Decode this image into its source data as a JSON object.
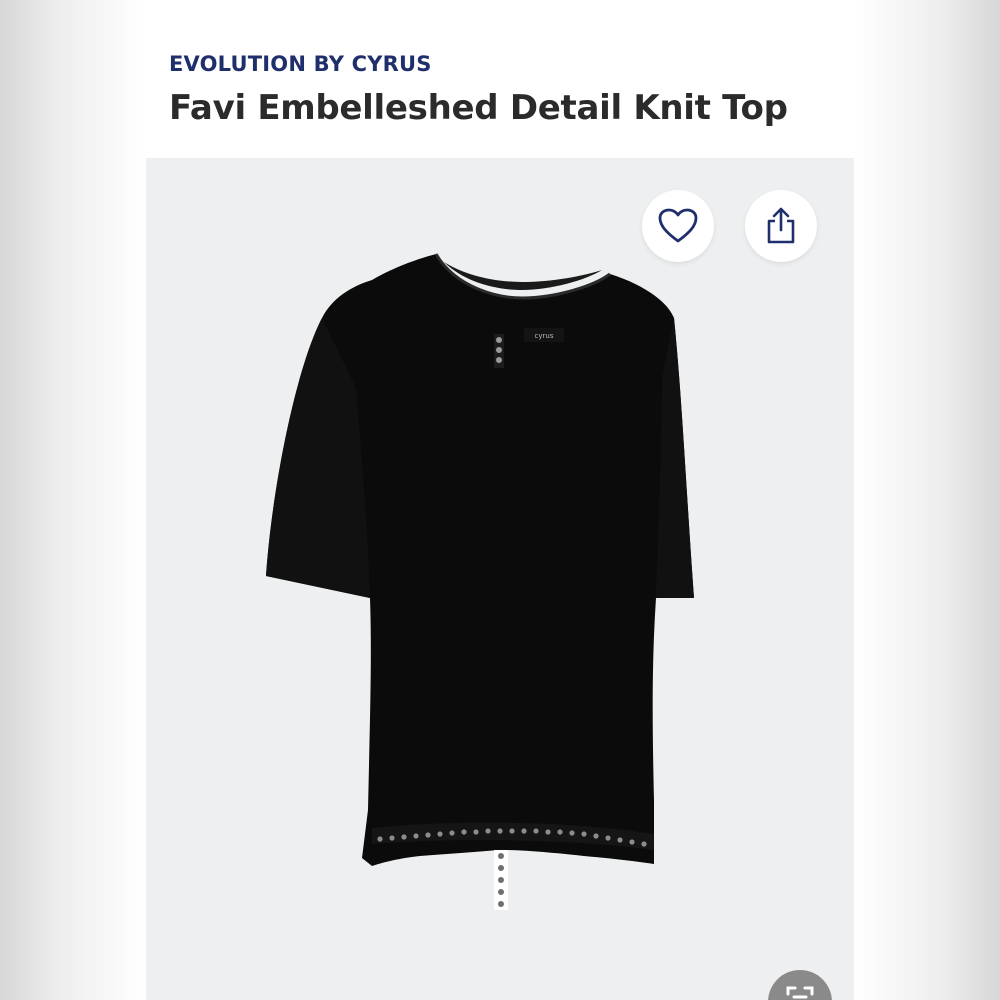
{
  "product": {
    "brand": "EVOLUTION BY CYRUS",
    "title": "Favi Embelleshed Detail Knit Top",
    "shirt_label": "cyrus"
  },
  "actions": {
    "favorite_icon": "heart-icon",
    "share_icon": "share-icon",
    "visual_search_icon": "scan-icon"
  },
  "colors": {
    "brand": "#1f2f6b",
    "title": "#2b2b2b",
    "photo_background": "#edeff0",
    "garment": "#0b0b0b"
  }
}
